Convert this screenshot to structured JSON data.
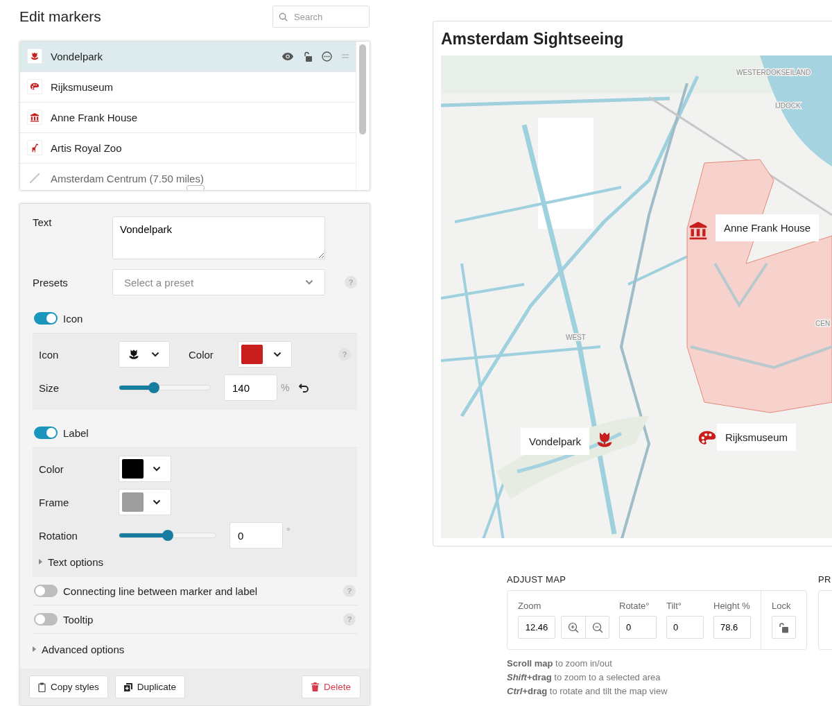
{
  "header": {
    "title": "Edit markers",
    "search": {
      "placeholder": "Search"
    }
  },
  "markers": [
    {
      "name": "Vondelpark",
      "kind": "tulip",
      "selected": true
    },
    {
      "name": "Rijksmuseum",
      "kind": "palette",
      "selected": false
    },
    {
      "name": "Anne Frank House",
      "kind": "museum",
      "selected": false
    },
    {
      "name": "Artis Royal Zoo",
      "kind": "giraffe",
      "selected": false
    },
    {
      "name": "Amsterdam Centrum (7.50 miles)",
      "kind": "line",
      "selected": false
    }
  ],
  "editor": {
    "text": {
      "label": "Text",
      "value": "Vondelpark"
    },
    "presets": {
      "label": "Presets",
      "placeholder": "Select a preset",
      "help": "?"
    },
    "icon_section": {
      "label": "Icon",
      "on": true,
      "icon_label": "Icon",
      "color_label": "Color",
      "color": "#c81e1e",
      "help": "?",
      "size_label": "Size",
      "size": {
        "level": 0.38,
        "value": "140",
        "unit": "%"
      }
    },
    "label_section": {
      "label": "Label",
      "on": true,
      "color_label": "Color",
      "color": "#000000",
      "frame": {
        "label": "Frame",
        "color": "#9e9e9e"
      },
      "rotation_label": "Rotation",
      "rotation": {
        "level": 0.5,
        "value": "0",
        "unit": "°"
      },
      "text_options": "Text options"
    },
    "options": [
      {
        "label": "Connecting line between marker and label",
        "on": false,
        "help": "?"
      },
      {
        "label": "Tooltip",
        "on": false,
        "help": "?"
      }
    ],
    "advanced": "Advanced options",
    "buttons": [
      {
        "label": "Copy styles",
        "kind": "copy"
      },
      {
        "label": "Duplicate",
        "kind": "duplicate"
      },
      {
        "label": "Delete",
        "kind": "delete"
      }
    ]
  },
  "map": {
    "title": "Amsterdam Sightseeing",
    "place_labels": [
      "WESTERDOKSEILAND",
      "IJDOCK",
      "WEST",
      "CEN"
    ],
    "pins": [
      {
        "label": "Anne Frank House",
        "kind": "museum"
      },
      {
        "label": "Vondelpark",
        "kind": "tulip"
      },
      {
        "label": "Rijksmuseum",
        "kind": "palette"
      }
    ]
  },
  "adjust": {
    "heading": "ADJUST MAP",
    "zoom": {
      "label": "Zoom",
      "value": "12.46"
    },
    "fields": [
      {
        "label": "Rotate°",
        "value": "0"
      },
      {
        "label": "Tilt°",
        "value": "0"
      },
      {
        "label": "Height %",
        "value": "78.6"
      }
    ],
    "lock": "Lock",
    "hints": [
      {
        "bold": "Scroll map",
        "text": " to zoom in/out"
      },
      {
        "italic": "Shift",
        "bold": "+drag",
        "text": " to zoom to a selected area"
      },
      {
        "italic": "Ctrl",
        "bold": "+drag",
        "text": " to rotate and tilt the map view"
      }
    ]
  },
  "next_heading": "PR"
}
